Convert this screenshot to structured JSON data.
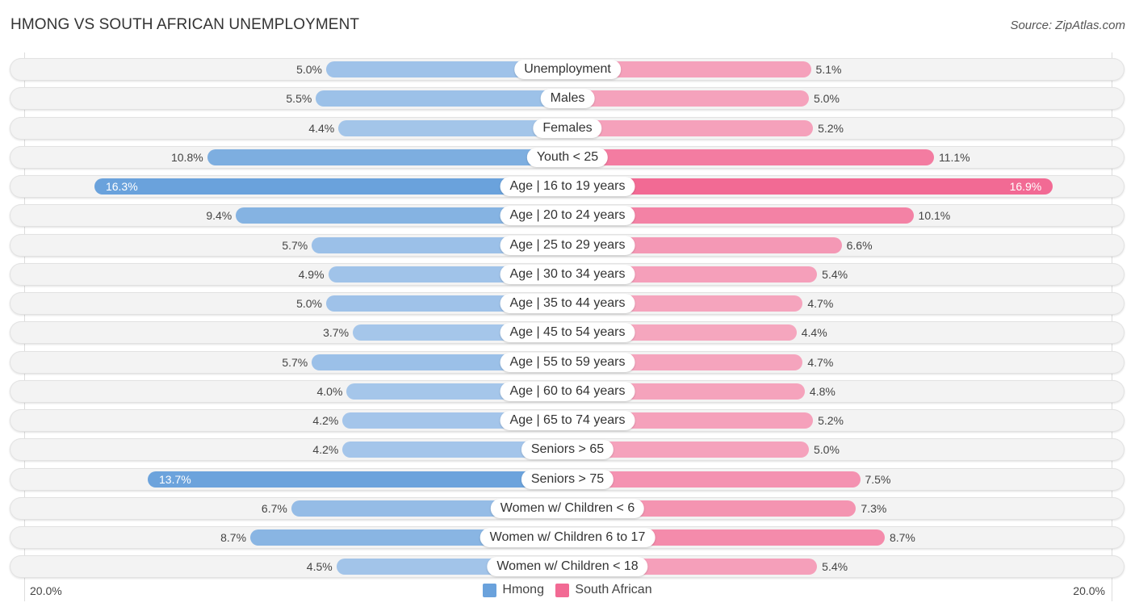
{
  "header": {
    "title": "HMONG VS SOUTH AFRICAN UNEMPLOYMENT",
    "source": "Source: ZipAtlas.com"
  },
  "colors": {
    "hmong_strong": "#6aa2dc",
    "hmong_light": "#a5c6ea",
    "south_african_strong": "#f26a94",
    "south_african_light": "#f5a8c0"
  },
  "chart_data": {
    "type": "bar",
    "orientation": "horizontal-diverging",
    "title": "HMONG VS SOUTH AFRICAN UNEMPLOYMENT",
    "categories": [
      "Unemployment",
      "Males",
      "Females",
      "Youth < 25",
      "Age | 16 to 19 years",
      "Age | 20 to 24 years",
      "Age | 25 to 29 years",
      "Age | 30 to 34 years",
      "Age | 35 to 44 years",
      "Age | 45 to 54 years",
      "Age | 55 to 59 years",
      "Age | 60 to 64 years",
      "Age | 65 to 74 years",
      "Seniors > 65",
      "Seniors > 75",
      "Women w/ Children < 6",
      "Women w/ Children 6 to 17",
      "Women w/ Children < 18"
    ],
    "series": [
      {
        "name": "Hmong",
        "side": "left",
        "values": [
          5.0,
          5.5,
          4.4,
          10.8,
          16.3,
          9.4,
          5.7,
          4.9,
          5.0,
          3.7,
          5.7,
          4.0,
          4.2,
          4.2,
          13.7,
          6.7,
          8.7,
          4.5
        ],
        "labels": [
          "5.0%",
          "5.5%",
          "4.4%",
          "10.8%",
          "16.3%",
          "9.4%",
          "5.7%",
          "4.9%",
          "5.0%",
          "3.7%",
          "5.7%",
          "4.0%",
          "4.2%",
          "4.2%",
          "13.7%",
          "6.7%",
          "8.7%",
          "4.5%"
        ]
      },
      {
        "name": "South African",
        "side": "right",
        "values": [
          5.1,
          5.0,
          5.2,
          11.1,
          16.9,
          10.1,
          6.6,
          5.4,
          4.7,
          4.4,
          4.7,
          4.8,
          5.2,
          5.0,
          7.5,
          7.3,
          8.7,
          5.4
        ],
        "labels": [
          "5.1%",
          "5.0%",
          "5.2%",
          "11.1%",
          "16.9%",
          "10.1%",
          "6.6%",
          "5.4%",
          "4.7%",
          "4.4%",
          "4.7%",
          "4.8%",
          "5.2%",
          "5.0%",
          "7.5%",
          "7.3%",
          "8.7%",
          "5.4%"
        ]
      }
    ],
    "xlim": [
      0,
      20
    ],
    "axis_labels": {
      "left": "20.0%",
      "right": "20.0%"
    },
    "legend": [
      {
        "name": "Hmong",
        "color": "#6aa2dc"
      },
      {
        "name": "South African",
        "color": "#f26a94"
      }
    ],
    "legend_position": "bottom-center",
    "grid": false
  }
}
